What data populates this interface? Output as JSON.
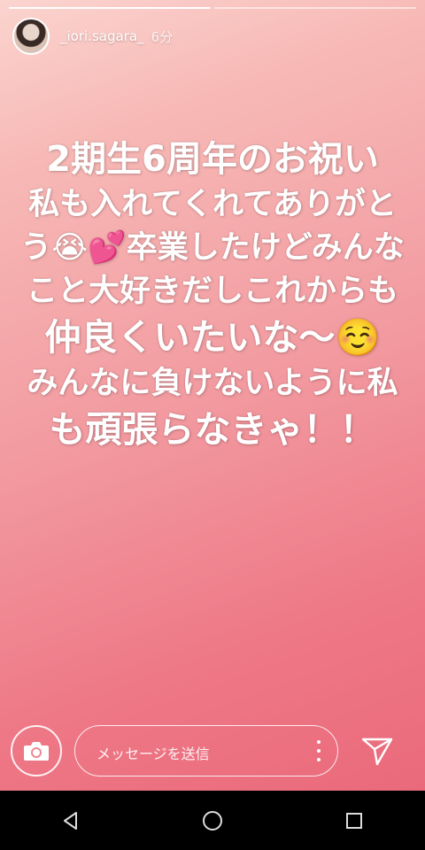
{
  "story": {
    "username": "_iori.sagara_",
    "time": "6分",
    "progress_segments": 2,
    "active_segment": 1,
    "lines": [
      "2期生6周年のお祝い",
      "私も入れてくれてありがと",
      "う😭💕卒業したけどみんな",
      "こと大好きだしこれからも",
      "仲良くいたいな〜☺️",
      "みんなに負けないように私",
      "も頑張らなきゃ！！"
    ]
  },
  "reply": {
    "placeholder": "メッセージを送信"
  },
  "icons": {
    "camera": "camera-icon",
    "more": "more-vertical-icon",
    "send": "send-icon",
    "back": "back-triangle-icon",
    "home": "home-circle-icon",
    "recents": "recents-square-icon"
  },
  "colors": {
    "gradient_top": "#fbd4cf",
    "gradient_bottom": "#ea6a7b",
    "text": "#ffffff",
    "navbar": "#000000"
  }
}
